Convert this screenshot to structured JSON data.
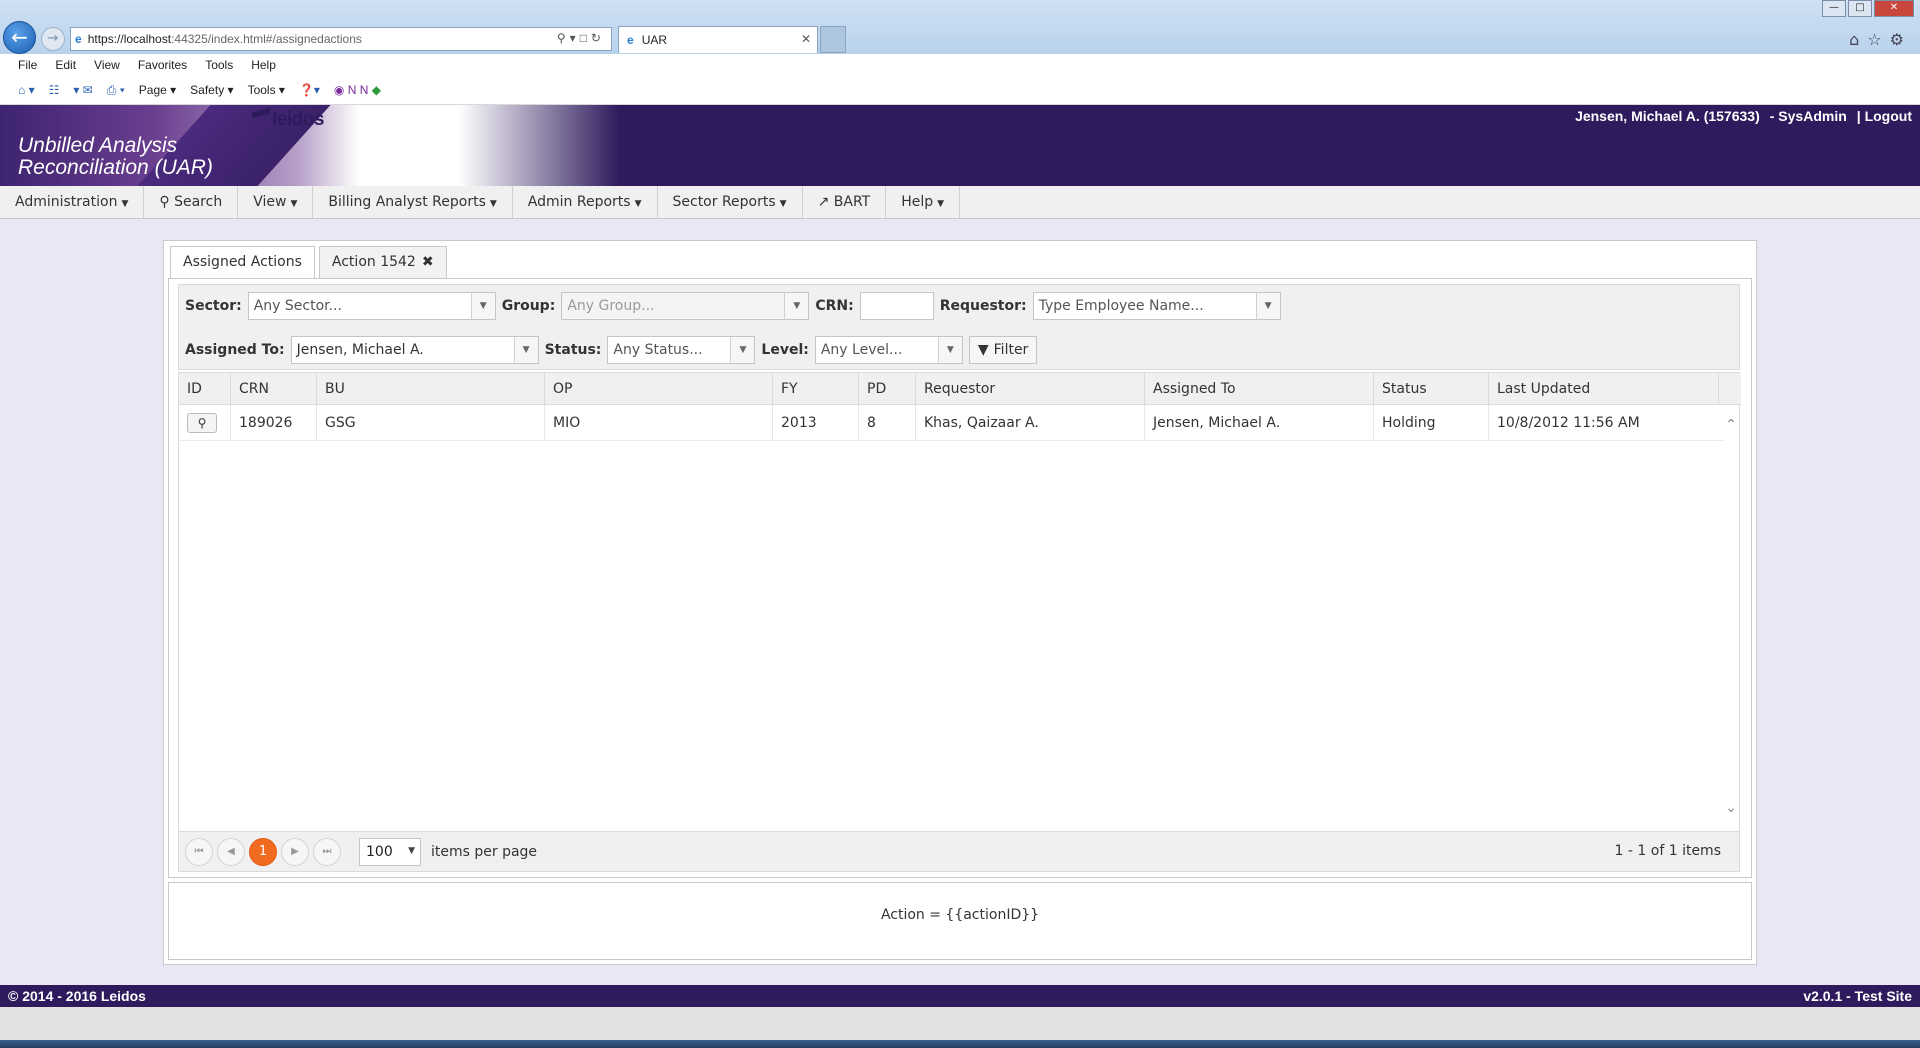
{
  "browser": {
    "url_host": "https://localhost",
    "url_rest": ":44325/index.html#/assignedactions",
    "tab_title": "UAR",
    "menu": [
      "File",
      "Edit",
      "View",
      "Favorites",
      "Tools",
      "Help"
    ],
    "commands": [
      "Page",
      "Safety",
      "Tools"
    ]
  },
  "header": {
    "logo": "leidos",
    "app_title": "Unbilled Analysis Reconciliation (UAR)",
    "user": "Jensen, Michael A. (157633)",
    "role": "- SysAdmin",
    "logout": "| Logout"
  },
  "nav": {
    "items": [
      {
        "label": "Administration",
        "caret": true
      },
      {
        "label": "Search",
        "icon": "search-icon"
      },
      {
        "label": "View",
        "caret": true
      },
      {
        "label": "Billing Analyst Reports",
        "caret": true
      },
      {
        "label": "Admin Reports",
        "caret": true
      },
      {
        "label": "Sector Reports",
        "caret": true
      },
      {
        "label": "BART",
        "icon": "external-link-icon"
      },
      {
        "label": "Help",
        "caret": true
      }
    ]
  },
  "tabs": [
    {
      "label": "Assigned Actions",
      "active": true
    },
    {
      "label": "Action 1542",
      "closable": true
    }
  ],
  "filters": {
    "sector_label": "Sector:",
    "sector_placeholder": "Any Sector...",
    "group_label": "Group:",
    "group_placeholder": "Any Group...",
    "crn_label": "CRN:",
    "crn_value": "",
    "requestor_label": "Requestor:",
    "requestor_placeholder": "Type Employee Name...",
    "assigned_label": "Assigned To:",
    "assigned_value": "Jensen, Michael A.",
    "status_label": "Status:",
    "status_placeholder": "Any Status...",
    "level_label": "Level:",
    "level_placeholder": "Any Level...",
    "filter_button": "Filter"
  },
  "grid": {
    "columns": [
      "ID",
      "CRN",
      "BU",
      "OP",
      "FY",
      "PD",
      "Requestor",
      "Assigned To",
      "Status",
      "Last Updated"
    ],
    "rows": [
      {
        "crn": "189026",
        "bu": "GSG",
        "op": "MIO",
        "fy": "2013",
        "pd": "8",
        "requestor": "Khas, Qaizaar A.",
        "assigned": "Jensen, Michael A.",
        "status": "Holding",
        "updated": "10/8/2012 11:56 AM"
      }
    ]
  },
  "pager": {
    "current_page": "1",
    "page_size": "100",
    "items_per_page": "items per page",
    "info": "1 - 1 of 1 items"
  },
  "detail": "Action = {{actionID}}",
  "footer": {
    "copyright": "© 2014 - 2016 Leidos",
    "version": "v2.0.1 - Test Site"
  },
  "colors": {
    "brand_purple": "#2e1a5c",
    "accent_orange": "#f06a1f"
  }
}
